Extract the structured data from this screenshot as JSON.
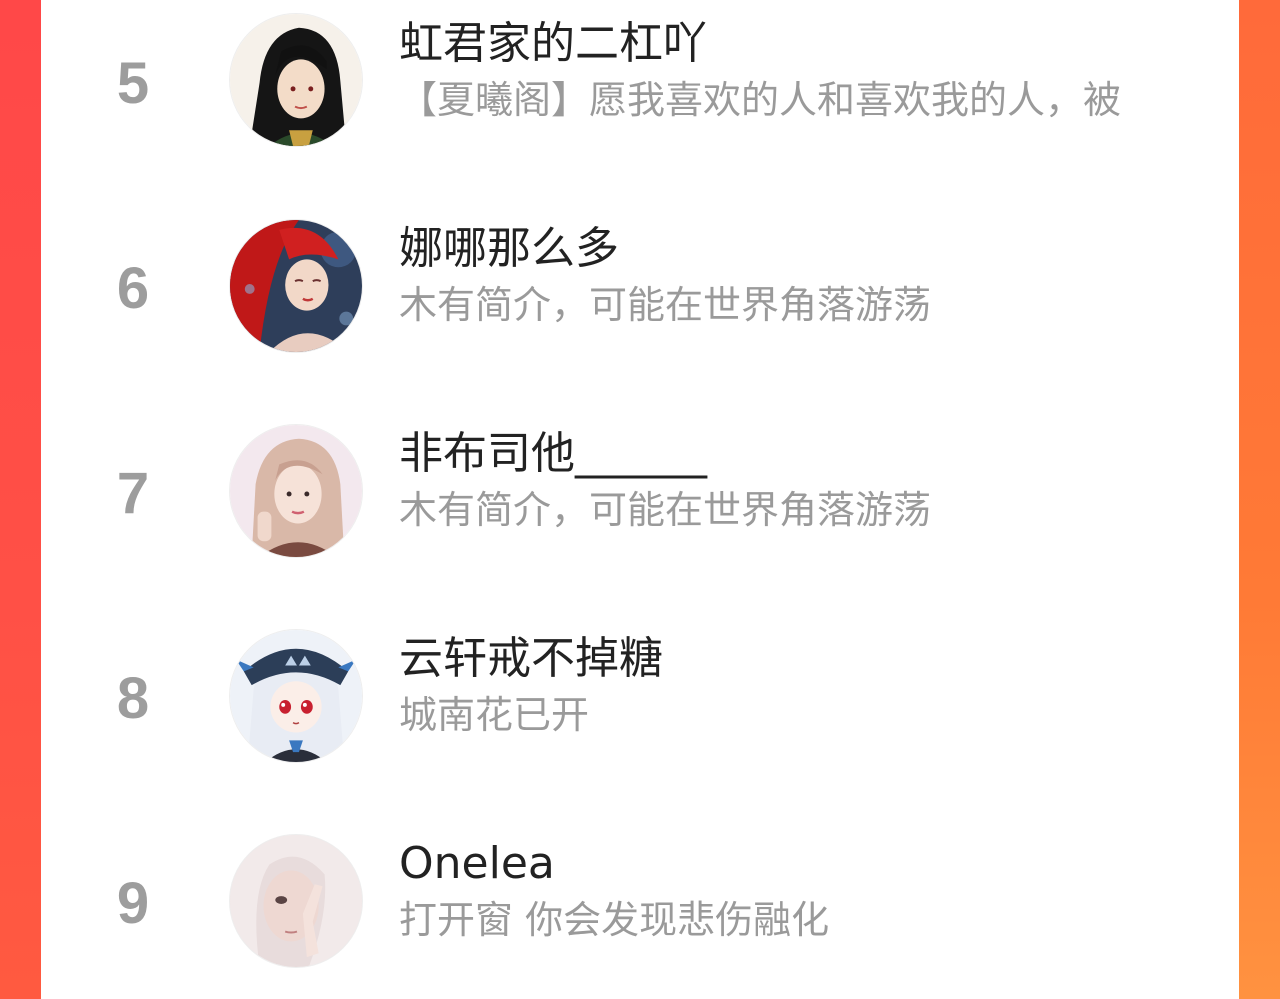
{
  "colors": {
    "accent_left": "#ff4848",
    "accent_right": "#ff7a36",
    "rank_number": "#9d9d9d",
    "name_text": "#222222",
    "bio_text": "#9a9a9a"
  },
  "ranking": {
    "items": [
      {
        "rank": "5",
        "name": "虹君家的二杠吖",
        "bio": "【夏曦阁】愿我喜欢的人和喜欢我的人，被",
        "avatar": "avatar-black-hair-man-icon"
      },
      {
        "rank": "6",
        "name": "娜哪那么多",
        "bio": "木有简介，可能在世界角落游荡",
        "avatar": "avatar-red-hair-girl-icon"
      },
      {
        "rank": "7",
        "name": "非布司他______",
        "bio": "木有简介，可能在世界角落游荡",
        "avatar": "avatar-blonde-girl-icon"
      },
      {
        "rank": "8",
        "name": "云轩戒不掉糖",
        "bio": "城南花已开",
        "avatar": "avatar-anime-white-hair-girl-icon"
      },
      {
        "rank": "9",
        "name": "Onelea",
        "bio": "打开窗 你会发现悲伤融化",
        "avatar": "avatar-pale-girl-icon"
      }
    ]
  }
}
